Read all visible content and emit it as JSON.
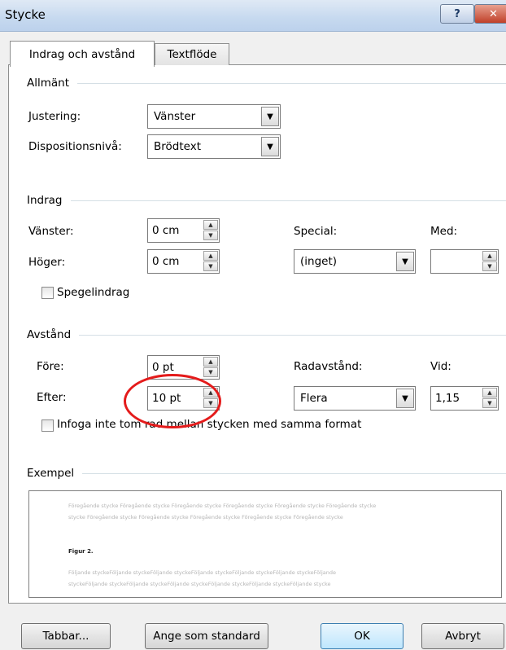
{
  "window": {
    "title": "Stycke",
    "help_label": "?",
    "close_label": "✕"
  },
  "tabs": [
    {
      "label": "Indrag och avstånd",
      "active": true
    },
    {
      "label": "Textflöde",
      "active": false
    }
  ],
  "general": {
    "heading": "Allmänt",
    "alignment_label": "Justering:",
    "alignment_value": "Vänster",
    "outline_label": "Dispositionsnivå:",
    "outline_value": "Brödtext"
  },
  "indent": {
    "heading": "Indrag",
    "left_label": "Vänster:",
    "left_value": "0 cm",
    "right_label": "Höger:",
    "right_value": "0 cm",
    "special_label": "Special:",
    "special_value": "(inget)",
    "by_label": "Med:",
    "by_value": "",
    "mirror_label": "Spegelindrag"
  },
  "spacing": {
    "heading": "Avstånd",
    "before_label": "Före:",
    "before_value": "0 pt",
    "after_label": "Efter:",
    "after_value": "10 pt",
    "line_label": "Radavstånd:",
    "line_value": "Flera",
    "at_label": "Vid:",
    "at_value": "1,15",
    "dont_add_label": "Infoga inte tom rad mellan stycken med samma format"
  },
  "preview": {
    "heading": "Exempel",
    "prev_line1": "Föregående stycke Föregående stycke Föregående stycke Föregående stycke Föregående stycke Föregående stycke",
    "prev_line2": "stycke Föregående stycke Föregående stycke Föregående stycke Föregående stycke Föregående stycke",
    "current": "Figur 2.",
    "next_line1": "Följande styckeFöljande styckeFöljande styckeFöljande styckeFöljande styckeFöljande styckeFöljande",
    "next_line2": "styckeFöljande styckeFöljande styckeFöljande styckeFöljande styckeFöljande styckeFöljande stycke"
  },
  "buttons": {
    "tabs": "Tabbar...",
    "default": "Ange som standard",
    "ok": "OK",
    "cancel": "Avbryt"
  },
  "colors": {
    "highlight_circle": "#e41b1b",
    "ok_border": "#3c7fb1"
  }
}
